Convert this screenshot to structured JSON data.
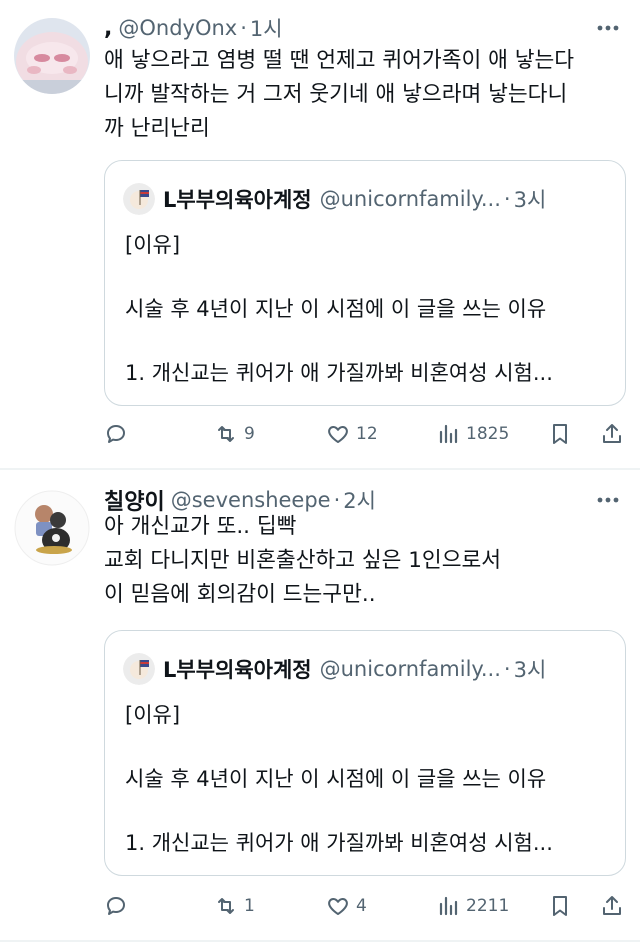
{
  "posts": [
    {
      "display_name": ",",
      "handle": "@OndyOnx",
      "separator": "·",
      "time": "1시",
      "lines": [
        "애 낳으라고 염병 떨 땐 언제고 퀴어가족이 애 낳는다",
        "니까 발작하는 거 그저 웃기네 애 낳으라며 낳는다니",
        "까 난리난리"
      ],
      "quote": {
        "name": "L부부의육아계정",
        "handle": "@unicornfamily...",
        "separator": "·",
        "time": "3시",
        "line1": "[이유]",
        "line2": "시술 후 4년이 지난 이 시점에 이 글을 쓰는 이유",
        "line3": "1. 개신교는 퀴어가 애 가질까봐 비혼여성 시험..."
      },
      "stats": {
        "reposts": "9",
        "likes": "12",
        "views": "1825"
      }
    },
    {
      "display_name": "칠양이",
      "handle": "@sevensheepe",
      "separator": "·",
      "time": "2시",
      "lines": [
        "아 개신교가 또.. 딥빡",
        "교회 다니지만 비혼출산하고 싶은 1인으로서",
        "이 믿음에 회의감이 드는구만.."
      ],
      "quote": {
        "name": "L부부의육아계정",
        "handle": "@unicornfamily...",
        "separator": "·",
        "time": "3시",
        "line1": "[이유]",
        "line2": "시술 후 4년이 지난 이 시점에 이 글을 쓰는 이유",
        "line3": "1. 개신교는 퀴어가 애 가질까봐 비혼여성 시험..."
      },
      "stats": {
        "reposts": "1",
        "likes": "4",
        "views": "2211"
      }
    }
  ],
  "icons": {
    "more": "more-horizontal-icon",
    "reply": "reply-icon",
    "repost": "repost-icon",
    "like": "heart-icon",
    "views": "views-icon",
    "bookmark": "bookmark-icon",
    "share": "share-icon"
  },
  "colors": {
    "text": "#0f1419",
    "secondary": "#536471",
    "border": "#cfd9de",
    "divider": "#eff3f4"
  }
}
